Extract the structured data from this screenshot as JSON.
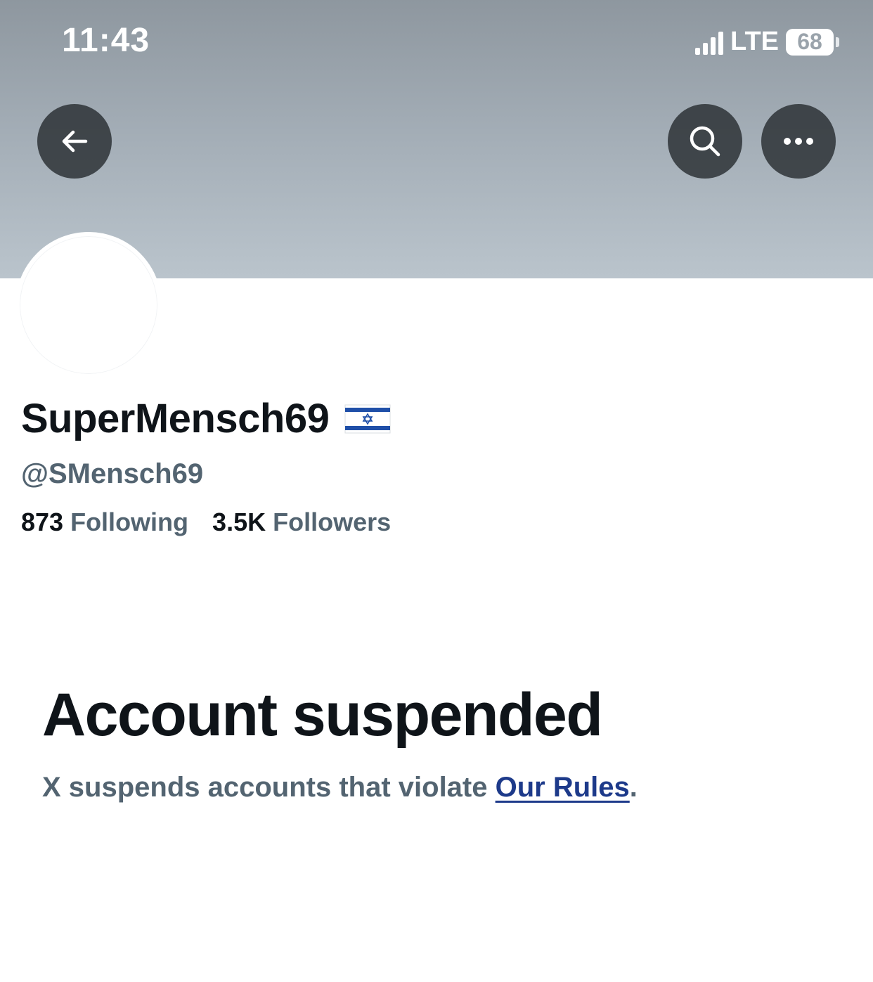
{
  "status_bar": {
    "time": "11:43",
    "network": "LTE",
    "battery": "68"
  },
  "header": {
    "back_icon": "arrow-left-icon",
    "search_icon": "search-icon",
    "more_icon": "more-horizontal-icon"
  },
  "profile": {
    "display_name": "SuperMensch69",
    "name_emoji": "israel-flag-icon",
    "handle": "@SMensch69",
    "following_count": "873",
    "following_label": "Following",
    "followers_count": "3.5K",
    "followers_label": "Followers"
  },
  "suspension": {
    "title": "Account suspended",
    "message": "X suspends accounts that violate ",
    "link_text": "Our Rules",
    "trailing": "."
  },
  "colors": {
    "text_primary": "#0f1419",
    "text_secondary": "#536471",
    "link": "#1d3a8a",
    "header_button": "#2b2f33"
  }
}
